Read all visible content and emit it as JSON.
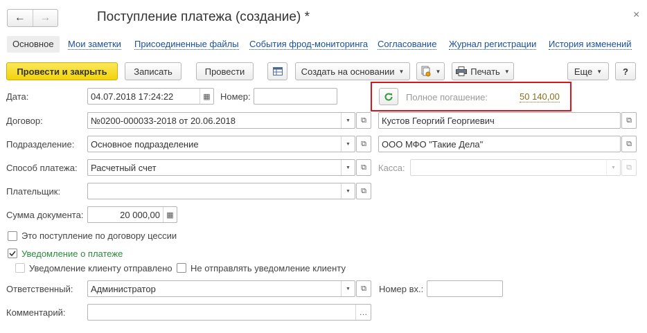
{
  "header": {
    "title": "Поступление платежа (создание) *",
    "back_glyph": "←",
    "forward_glyph": "→",
    "close_glyph": "×"
  },
  "tabs": [
    {
      "label": "Основное"
    },
    {
      "label": "Мои заметки"
    },
    {
      "label": "Присоединенные файлы"
    },
    {
      "label": "События фрод-мониторинга"
    },
    {
      "label": "Согласование"
    },
    {
      "label": "Журнал регистрации"
    },
    {
      "label": "История изменений"
    }
  ],
  "toolbar": {
    "post_close": "Провести и закрыть",
    "save": "Записать",
    "post": "Провести",
    "create_based": "Создать на основании",
    "print": "Печать",
    "more": "Еще",
    "help": "?"
  },
  "form": {
    "date_label": "Дата:",
    "date_value": "04.07.2018 17:24:22",
    "number_label": "Номер:",
    "number_value": "",
    "full_repayment_label": "Полное погашение:",
    "full_repayment_value": "50 140,00",
    "contract_label": "Договор:",
    "contract_value": "№0200-000033-2018 от 20.06.2018",
    "client_value": "Кустов Георгий Георгиевич",
    "division_label": "Подразделение:",
    "division_value": "Основное подразделение",
    "org_value": "ООО МФО \"Такие Дела\"",
    "payment_method_label": "Способ платежа:",
    "payment_method_value": "Расчетный счет",
    "cashbox_label": "Касса:",
    "cashbox_value": "",
    "payer_label": "Плательщик:",
    "payer_value": "",
    "amount_label": "Сумма документа:",
    "amount_value": "20 000,00",
    "cession_label": "Это поступление по договору цессии",
    "cession_checked": false,
    "notification_label": "Уведомление о платеже",
    "notification_checked": true,
    "client_notified_label": "Уведомление клиенту отправлено",
    "client_notified_checked": false,
    "dont_send_label": "Не отправлять уведомление клиенту",
    "dont_send_checked": false,
    "responsible_label": "Ответственный:",
    "responsible_value": "Администратор",
    "incoming_number_label": "Номер вх.:",
    "incoming_number_value": "",
    "comment_label": "Комментарий:",
    "comment_value": ""
  },
  "colors": {
    "primary_button": "#f2d30a",
    "link": "#1a4fa0",
    "highlight_border": "#d9141c",
    "amount_link": "#8a6d1d",
    "notification_green": "#2b8a3e"
  }
}
